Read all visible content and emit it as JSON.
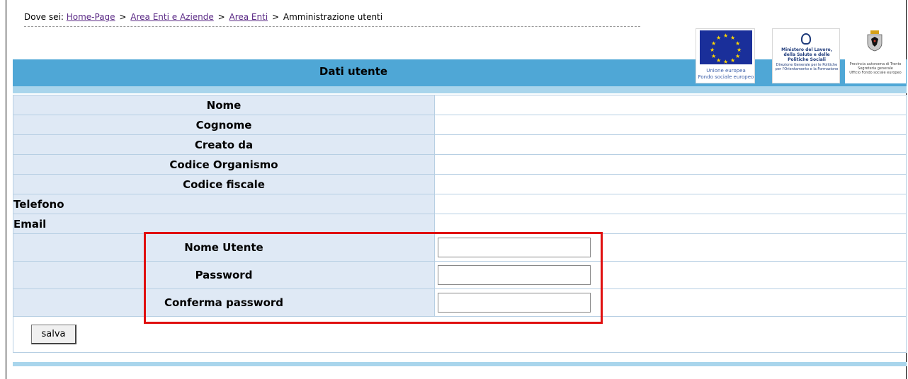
{
  "breadcrumb": {
    "prefix": "Dove sei:",
    "links": [
      "Home-Page",
      "Area Enti e Aziende",
      "Area Enti"
    ],
    "separator": ">",
    "current": "Amministrazione utenti"
  },
  "logos": {
    "eu": {
      "line1": "Unione europea",
      "line2": "Fondo sociale europeo"
    },
    "ministero": {
      "line1": "Ministero del Lavoro,",
      "line2": "della Salute e delle Politiche Sociali",
      "line3": "Direzione Generale per le Politiche",
      "line4": "per l'Orientamento e la Formazione"
    },
    "provincia": {
      "line1": "Provincia autonoma di Trento",
      "line2": "Segreteria generale",
      "line3": "Ufficio Fondo sociale europeo"
    }
  },
  "header": {
    "title": "Dati utente"
  },
  "fields": {
    "nome": "Nome",
    "cognome": "Cognome",
    "creato_da": "Creato da",
    "codice_organismo": "Codice Organismo",
    "codice_fiscale": "Codice fiscale",
    "telefono": "Telefono",
    "email": "Email",
    "nome_utente": "Nome Utente",
    "password": "Password",
    "conferma_password": "Conferma password"
  },
  "inputs": {
    "nome_utente": "",
    "password": "",
    "conferma_password": ""
  },
  "actions": {
    "save_label": "salva"
  },
  "colors": {
    "header": "#4fa7d6",
    "label_bg": "#dfe9f5",
    "highlight": "#e01010",
    "link": "#5b2a86"
  }
}
